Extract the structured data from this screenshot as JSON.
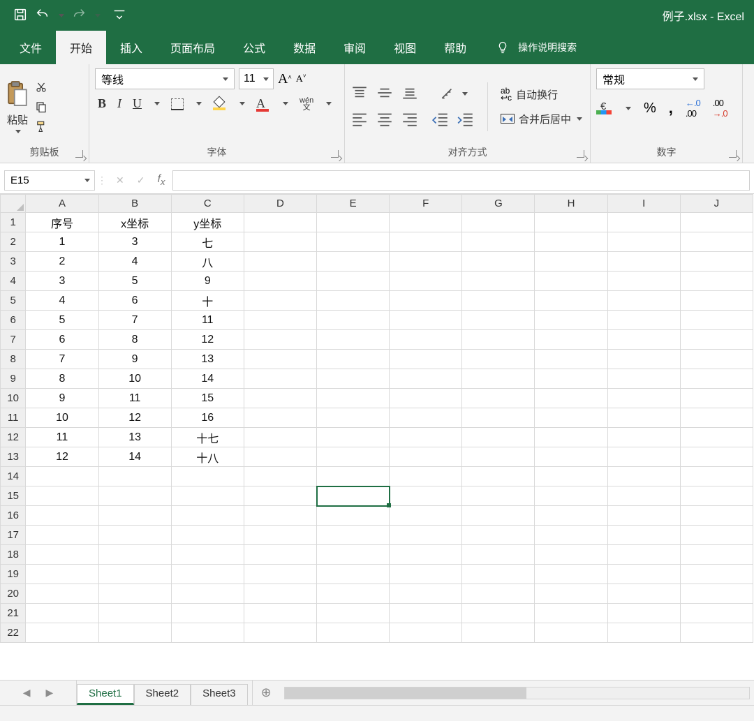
{
  "title": "例子.xlsx  -  Excel",
  "tabs": {
    "file": "文件",
    "home": "开始",
    "insert": "插入",
    "layout": "页面布局",
    "formulas": "公式",
    "data": "数据",
    "review": "审阅",
    "view": "视图",
    "help": "帮助",
    "tellme": "操作说明搜索"
  },
  "ribbon": {
    "paste": "粘贴",
    "clipboard": "剪贴板",
    "font": "字体",
    "align": "对齐方式",
    "number": "数字",
    "font_name": "等线",
    "font_size": "11",
    "wrap": "自动换行",
    "merge": "合并后居中",
    "num_format": "常规",
    "wen": "wén",
    "wen_char": "文"
  },
  "namebox": "E15",
  "columns": [
    "A",
    "B",
    "C",
    "D",
    "E",
    "F",
    "G",
    "H",
    "I",
    "J"
  ],
  "rows": [
    "1",
    "2",
    "3",
    "4",
    "5",
    "6",
    "7",
    "8",
    "9",
    "10",
    "11",
    "12",
    "13",
    "14",
    "15",
    "16",
    "17",
    "18",
    "19",
    "20",
    "21",
    "22"
  ],
  "cells": {
    "A1": "序号",
    "B1": "x坐标",
    "C1": "y坐标",
    "A2": "1",
    "B2": "3",
    "C2": "七",
    "A3": "2",
    "B3": "4",
    "C3": "八",
    "A4": "3",
    "B4": "5",
    "C4": "9",
    "A5": "4",
    "B5": "6",
    "C5": "十",
    "A6": "5",
    "B6": "7",
    "C6": "11",
    "A7": "6",
    "B7": "8",
    "C7": "12",
    "A8": "7",
    "B8": "9",
    "C8": "13",
    "A9": "8",
    "B9": "10",
    "C9": "14",
    "A10": "9",
    "B10": "11",
    "C10": "15",
    "A11": "10",
    "B11": "12",
    "C11": "16",
    "A12": "11",
    "B12": "13",
    "C12": "十七",
    "A13": "12",
    "B13": "14",
    "C13": "十八"
  },
  "selected_cell": "E15",
  "sheets": {
    "s1": "Sheet1",
    "s2": "Sheet2",
    "s3": "Sheet3"
  }
}
